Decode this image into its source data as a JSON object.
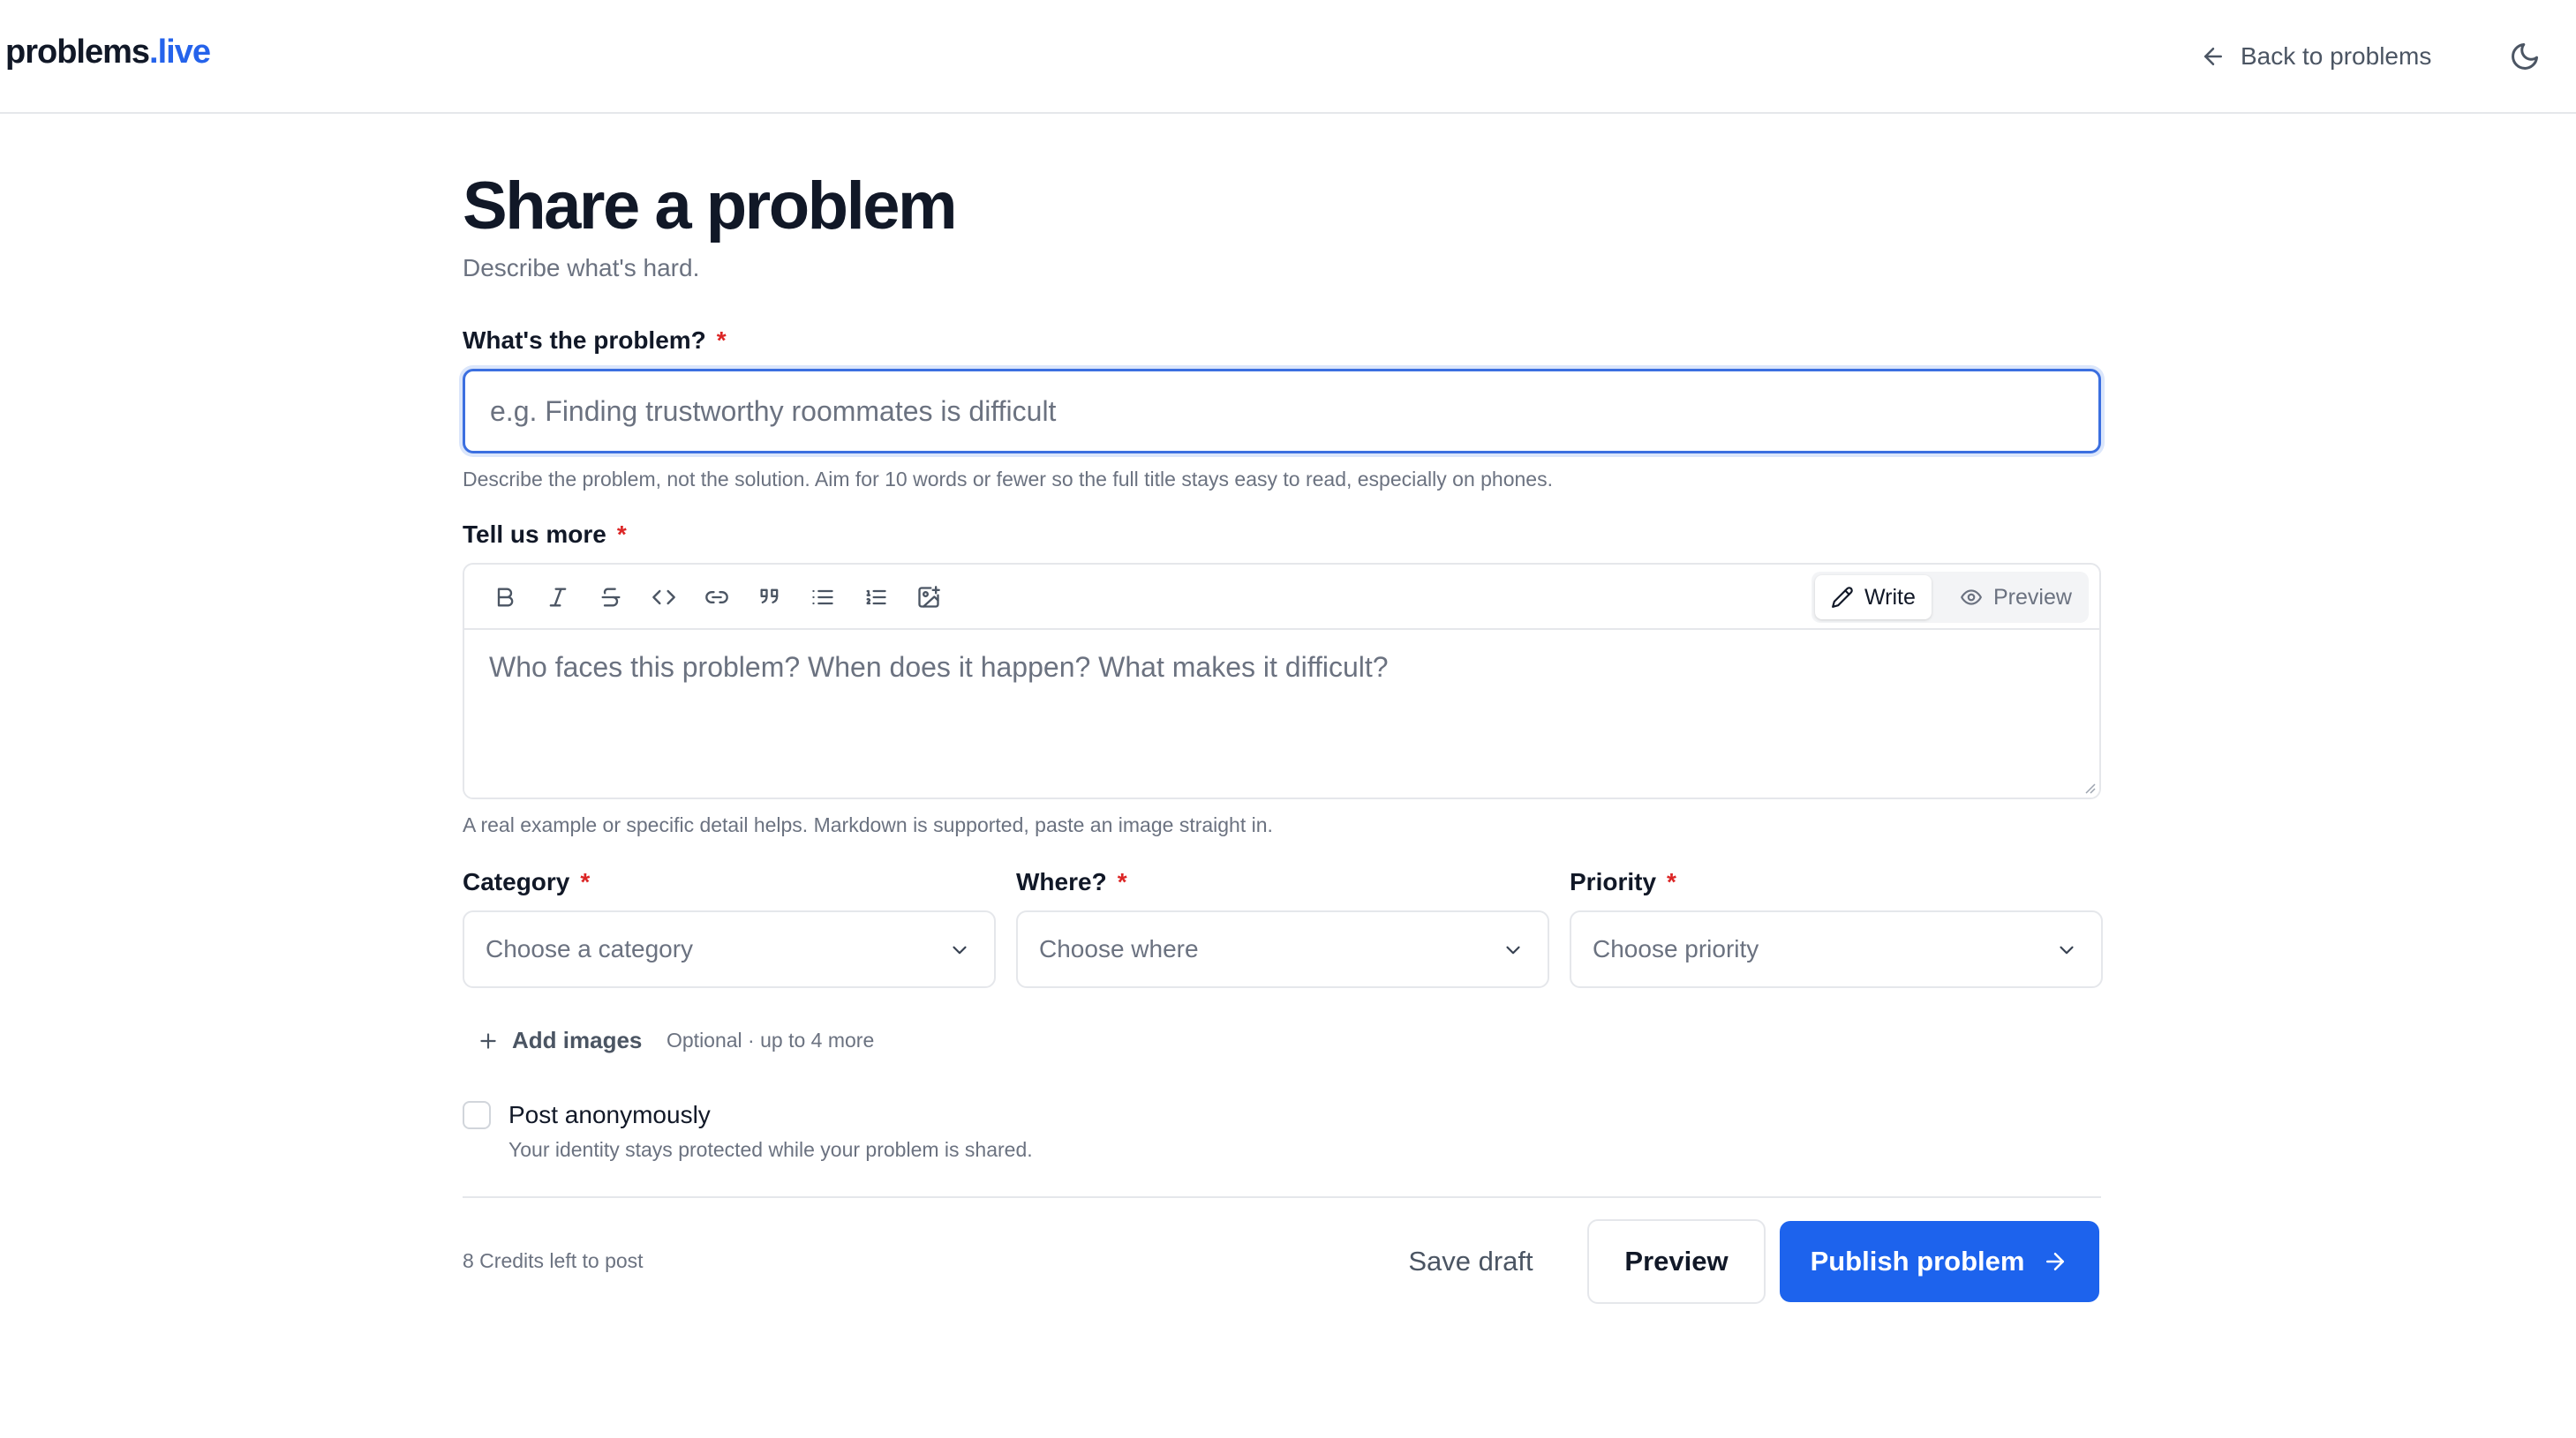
{
  "header": {
    "logo_main": "problems",
    "logo_accent": ".live",
    "back_label": "Back to problems",
    "back_icon": "arrow-left-icon",
    "theme_icon": "moon-icon"
  },
  "page": {
    "title": "Share a problem",
    "subtitle": "Describe what's hard."
  },
  "problem_field": {
    "label": "What's the problem?",
    "required_mark": "*",
    "value": "",
    "placeholder": "e.g. Finding trustworthy roommates is difficult",
    "hint": "Describe the problem, not the solution. Aim for 10 words or fewer so the full title stays easy to read, especially on phones."
  },
  "details_field": {
    "label": "Tell us more",
    "required_mark": "*",
    "value": "",
    "placeholder": "Who faces this problem? When does it happen? What makes it difficult?",
    "hint": "A real example or specific detail helps. Markdown is supported, paste an image straight in.",
    "toolbar": [
      "bold-icon",
      "italic-icon",
      "strikethrough-icon",
      "code-icon",
      "link-icon",
      "quote-icon",
      "bullet-list-icon",
      "numbered-list-icon",
      "image-icon"
    ],
    "mode_write": "Write",
    "mode_preview": "Preview",
    "active_mode": "Write"
  },
  "category": {
    "label": "Category",
    "required_mark": "*",
    "value": "Choose a category"
  },
  "where": {
    "label": "Where?",
    "required_mark": "*",
    "value": "Choose where"
  },
  "priority": {
    "label": "Priority",
    "required_mark": "*",
    "value": "Choose priority"
  },
  "images": {
    "add_label": "Add images",
    "hint": "Optional · up to 4 more"
  },
  "anonymous": {
    "label": "Post anonymously",
    "hint": "Your identity stays protected while your problem is shared.",
    "checked": false
  },
  "footer": {
    "credits": "8 Credits left to post",
    "save_draft": "Save draft",
    "preview": "Preview",
    "publish": "Publish problem"
  },
  "colors": {
    "accent": "#2563eb",
    "publish_button": "#1d63ed",
    "required": "#dc2626",
    "focus_border": "#3b6fe0"
  }
}
